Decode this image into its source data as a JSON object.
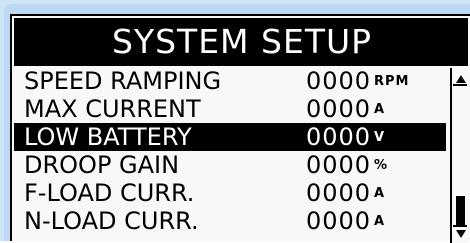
{
  "screen": {
    "title": "SYSTEM SETUP"
  },
  "menu": {
    "rows": [
      {
        "label": "SPEED RAMPING",
        "value": "0000",
        "unit": "RPM"
      },
      {
        "label": "MAX CURRENT",
        "value": "0000",
        "unit": "A"
      },
      {
        "label": "LOW BATTERY",
        "value": "0000",
        "unit": "V"
      },
      {
        "label": "DROOP GAIN",
        "value": "0000",
        "unit": "%"
      },
      {
        "label": "F-LOAD CURR.",
        "value": "0000",
        "unit": "A"
      },
      {
        "label": "N-LOAD CURR.",
        "value": "0000",
        "unit": "A"
      }
    ],
    "selected_row": "LOW BATTERY"
  },
  "scrollbar": {
    "up_icon": "arrow-up-icon",
    "down_icon": "arrow-down-icon",
    "position_fraction": 0.85
  },
  "colors": {
    "bezel": "#cfe3f6",
    "screen_bg": "#f8f8f8",
    "foreground": "#000000",
    "inverse_text": "#ffffff"
  }
}
